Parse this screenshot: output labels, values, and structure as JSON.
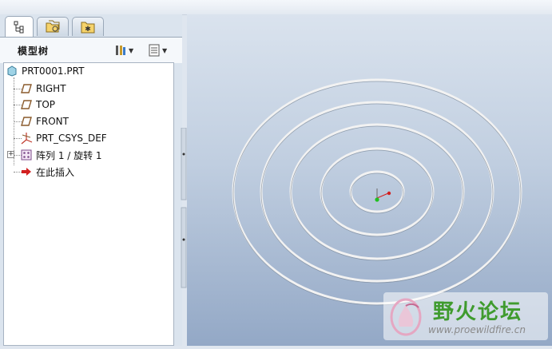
{
  "model_tree": {
    "title": "模型树",
    "tabs": [
      {
        "name": "model-tree-tab"
      },
      {
        "name": "folder-browser-tab"
      },
      {
        "name": "favorites-tab"
      }
    ],
    "items": [
      {
        "label": "PRT0001.PRT",
        "icon": "part-icon"
      },
      {
        "label": "RIGHT",
        "icon": "datum-plane-icon"
      },
      {
        "label": "TOP",
        "icon": "datum-plane-icon"
      },
      {
        "label": "FRONT",
        "icon": "datum-plane-icon"
      },
      {
        "label": "PRT_CSYS_DEF",
        "icon": "csys-icon"
      },
      {
        "label": "阵列 1 / 旋转 1",
        "icon": "pattern-icon"
      },
      {
        "label": "在此插入",
        "icon": "insert-here-arrow-icon"
      }
    ]
  },
  "watermark": {
    "title": "野火论坛",
    "url": "www.proewildfire.cn"
  },
  "colors": {
    "viewport_top": "#dae3ee",
    "viewport_bottom": "#93a8c6",
    "ring_stroke": "#f2f2f2",
    "datum_plane": "#8a5a2b"
  }
}
